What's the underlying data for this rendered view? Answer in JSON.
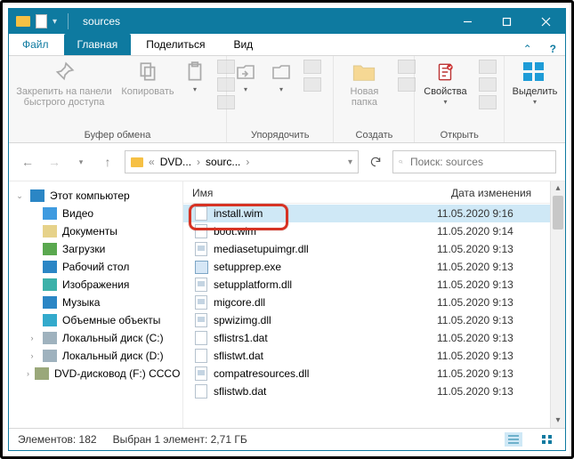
{
  "title": "sources",
  "tabs": {
    "file": "Файл",
    "home": "Главная",
    "share": "Поделиться",
    "view": "Вид"
  },
  "ribbon": {
    "pin": "Закрепить на панели\nбыстрого доступа",
    "copy": "Копировать",
    "newfolder": "Новая\nпапка",
    "properties": "Свойства",
    "select": "Выделить",
    "g1": "Буфер обмена",
    "g2": "Упорядочить",
    "g3": "Создать",
    "g4": "Открыть"
  },
  "address": {
    "crumb1": "DVD...",
    "crumb2": "sourc..."
  },
  "search": {
    "placeholder": "Поиск: sources"
  },
  "nav": {
    "root": "Этот компьютер",
    "items": [
      "Видео",
      "Документы",
      "Загрузки",
      "Рабочий стол",
      "Изображения",
      "Музыка",
      "Объемные объекты",
      "Локальный диск (C:)",
      "Локальный диск (D:)",
      "DVD-дисковод (F:) CCCO"
    ]
  },
  "columns": {
    "name": "Имя",
    "date": "Дата изменения"
  },
  "files": [
    {
      "name": "install.wim",
      "date": "11.05.2020 9:16",
      "t": "blank",
      "sel": true
    },
    {
      "name": "boot.wim",
      "date": "11.05.2020 9:14",
      "t": "blank"
    },
    {
      "name": "mediasetupuimgr.dll",
      "date": "11.05.2020 9:13",
      "t": "dll"
    },
    {
      "name": "setupprep.exe",
      "date": "11.05.2020 9:13",
      "t": "exe"
    },
    {
      "name": "setupplatform.dll",
      "date": "11.05.2020 9:13",
      "t": "dll"
    },
    {
      "name": "migcore.dll",
      "date": "11.05.2020 9:13",
      "t": "dll"
    },
    {
      "name": "spwizimg.dll",
      "date": "11.05.2020 9:13",
      "t": "dll"
    },
    {
      "name": "sflistrs1.dat",
      "date": "11.05.2020 9:13",
      "t": "blank"
    },
    {
      "name": "sflistwt.dat",
      "date": "11.05.2020 9:13",
      "t": "blank"
    },
    {
      "name": "compatresources.dll",
      "date": "11.05.2020 9:13",
      "t": "dll"
    },
    {
      "name": "sflistwb.dat",
      "date": "11.05.2020 9:13",
      "t": "blank"
    }
  ],
  "status": {
    "count": "Элементов: 182",
    "sel": "Выбран 1 элемент: 2,71 ГБ"
  }
}
